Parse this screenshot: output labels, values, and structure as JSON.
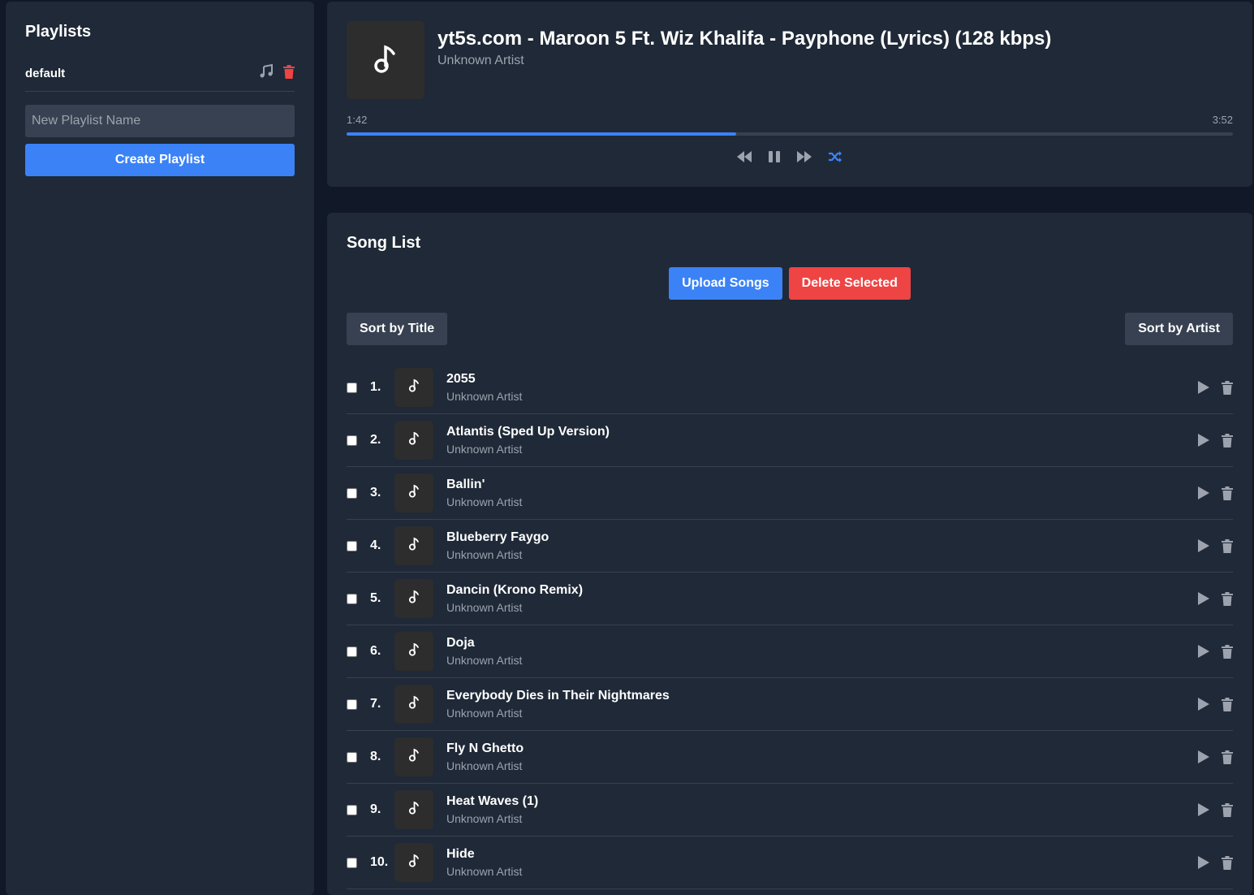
{
  "sidebar": {
    "title": "Playlists",
    "playlists": [
      {
        "name": "default",
        "icons": [
          "music-icon",
          "trash-icon"
        ]
      }
    ],
    "new_playlist_placeholder": "New Playlist Name",
    "create_label": "Create Playlist"
  },
  "player": {
    "title": "yt5s.com - Maroon 5 Ft. Wiz Khalifa - Payphone (Lyrics) (128 kbps)",
    "artist": "Unknown Artist",
    "current_time": "1:42",
    "duration": "3:52",
    "progress_fraction": 0.44,
    "controls": [
      "rewind-icon",
      "pause-icon",
      "fast-forward-icon",
      "shuffle-icon"
    ]
  },
  "song_list": {
    "title": "Song List",
    "upload_label": "Upload Songs",
    "delete_selected_label": "Delete Selected",
    "sort_title_label": "Sort by Title",
    "sort_artist_label": "Sort by Artist",
    "songs": [
      {
        "num": "1.",
        "title": "2055",
        "artist": "Unknown Artist"
      },
      {
        "num": "2.",
        "title": "Atlantis (Sped Up Version)",
        "artist": "Unknown Artist"
      },
      {
        "num": "3.",
        "title": "Ballin'",
        "artist": "Unknown Artist"
      },
      {
        "num": "4.",
        "title": "Blueberry Faygo",
        "artist": "Unknown Artist"
      },
      {
        "num": "5.",
        "title": "Dancin (Krono Remix)",
        "artist": "Unknown Artist"
      },
      {
        "num": "6.",
        "title": "Doja",
        "artist": "Unknown Artist"
      },
      {
        "num": "7.",
        "title": "Everybody Dies in Their Nightmares",
        "artist": "Unknown Artist"
      },
      {
        "num": "8.",
        "title": "Fly N Ghetto",
        "artist": "Unknown Artist"
      },
      {
        "num": "9.",
        "title": "Heat Waves (1)",
        "artist": "Unknown Artist"
      },
      {
        "num": "10.",
        "title": "Hide",
        "artist": "Unknown Artist"
      }
    ]
  },
  "colors": {
    "accent": "#3b82f6",
    "danger": "#ef4444",
    "panel": "#1f2937",
    "background": "#111827"
  }
}
